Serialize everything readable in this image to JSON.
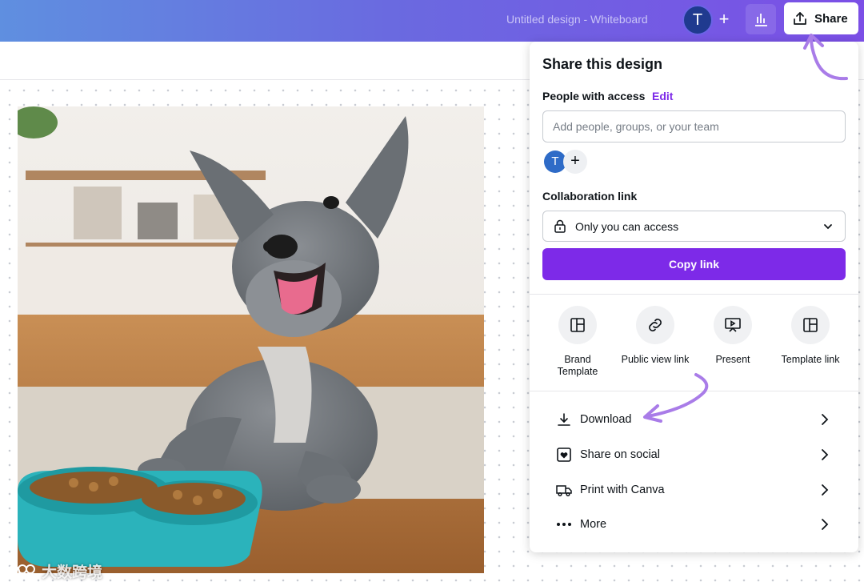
{
  "header": {
    "design_title": "Untitled design - Whiteboard",
    "avatar_initial": "T",
    "add_label": "+",
    "share_label": "Share"
  },
  "share_panel": {
    "title": "Share this design",
    "people_access_label": "People with access",
    "edit_label": "Edit",
    "add_people_placeholder": "Add people, groups, or your team",
    "member_initial": "T",
    "add_member_label": "+",
    "collaboration_label": "Collaboration link",
    "access_option": "Only you can access",
    "copy_link_label": "Copy link",
    "options": [
      {
        "label": "Brand\nTemplate",
        "icon": "template-icon"
      },
      {
        "label": "Public view link",
        "icon": "link-icon"
      },
      {
        "label": "Present",
        "icon": "present-icon"
      },
      {
        "label": "Template link",
        "icon": "template-icon"
      }
    ],
    "actions": [
      {
        "label": "Download",
        "icon": "download-icon"
      },
      {
        "label": "Share on social",
        "icon": "heart-icon"
      },
      {
        "label": "Print with Canva",
        "icon": "truck-icon"
      },
      {
        "label": "More",
        "icon": "more-icon"
      }
    ]
  },
  "watermark": "大数跨境",
  "colors": {
    "accent": "#7d2ae8",
    "annotation": "#a97ce8"
  }
}
